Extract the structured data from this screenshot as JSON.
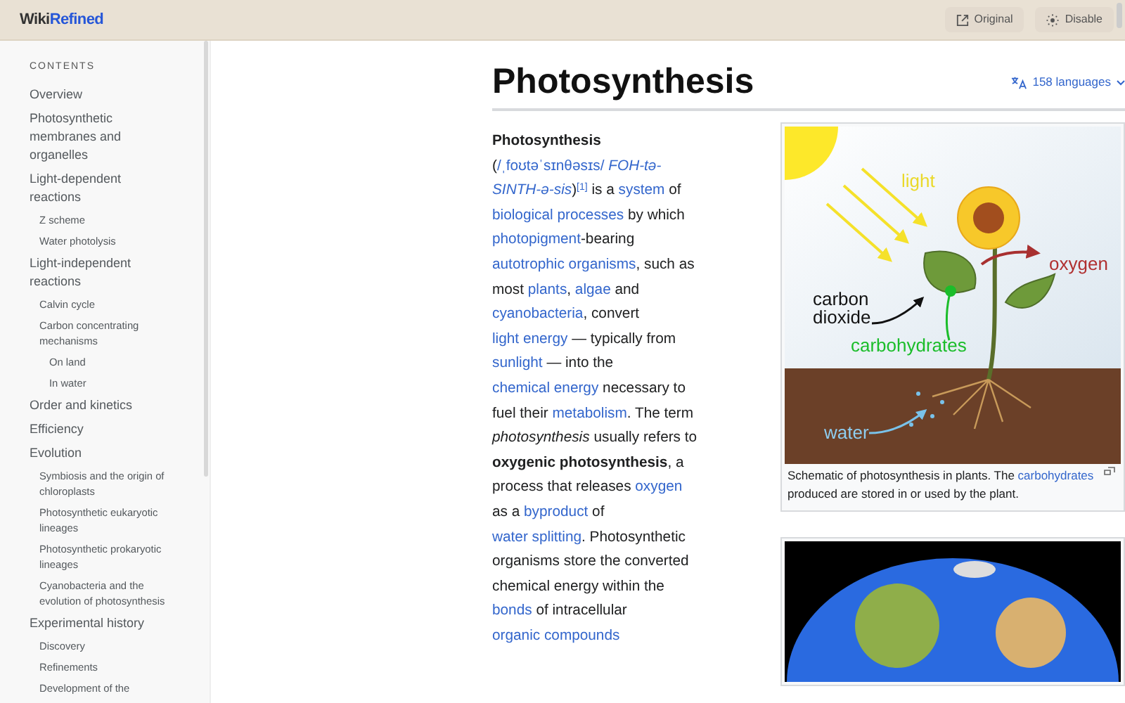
{
  "header": {
    "logo": {
      "prefix": "Wiki",
      "suffix": "Refined"
    },
    "buttons": [
      {
        "label": "Original",
        "kind": "external"
      },
      {
        "label": "Disable",
        "kind": "disable"
      }
    ]
  },
  "toc": {
    "heading": "CONTENTS",
    "items": [
      {
        "label": "Overview"
      },
      {
        "label": "Photosynthetic membranes and organelles"
      },
      {
        "label": "Light-dependent reactions",
        "children": [
          {
            "label": "Z scheme"
          },
          {
            "label": "Water photolysis"
          }
        ]
      },
      {
        "label": "Light-independent reactions",
        "children": [
          {
            "label": "Calvin cycle"
          },
          {
            "label": "Carbon concentrating mechanisms",
            "children": [
              {
                "label": "On land"
              },
              {
                "label": "In water"
              }
            ]
          }
        ]
      },
      {
        "label": "Order and kinetics"
      },
      {
        "label": "Efficiency"
      },
      {
        "label": "Evolution",
        "children": [
          {
            "label": "Symbiosis and the origin of chloroplasts"
          },
          {
            "label": "Photosynthetic eukaryotic lineages"
          },
          {
            "label": "Photosynthetic prokaryotic lineages"
          },
          {
            "label": "Cyanobacteria and the evolution of photosynthesis"
          }
        ]
      },
      {
        "label": "Experimental history",
        "children": [
          {
            "label": "Discovery"
          },
          {
            "label": "Refinements"
          },
          {
            "label": "Development of the"
          }
        ]
      }
    ]
  },
  "article": {
    "title": "Photosynthesis",
    "languages": "158 languages",
    "intro": [
      {
        "kind": "bold",
        "text": "Photosynthesis"
      },
      {
        "kind": "plain",
        "text": " ("
      },
      {
        "kind": "link",
        "text": "/ˌfoʊtəˈsɪnθəsɪs/"
      },
      {
        "kind": "italic-link",
        "text": "FOH-tə-"
      },
      {
        "kind": "italic-link",
        "text": "SINTH-ə-sis"
      },
      {
        "kind": "plain",
        "text": ")"
      },
      {
        "kind": "ref",
        "text": "[1]"
      },
      {
        "kind": "plain",
        "text": " is a "
      },
      {
        "kind": "link",
        "text": "system"
      },
      {
        "kind": "plain",
        "text": " of "
      },
      {
        "kind": "link",
        "text": "biological processes"
      },
      {
        "kind": "plain",
        "text": " by which "
      },
      {
        "kind": "link",
        "text": "photopigment"
      },
      {
        "kind": "plain",
        "text": "-bearing "
      },
      {
        "kind": "link",
        "text": "autotrophic organisms"
      },
      {
        "kind": "plain",
        "text": ", such as most "
      },
      {
        "kind": "link",
        "text": "plants"
      },
      {
        "kind": "plain",
        "text": ", "
      },
      {
        "kind": "link",
        "text": "algae"
      },
      {
        "kind": "plain",
        "text": " and "
      },
      {
        "kind": "link",
        "text": "cyanobacteria"
      },
      {
        "kind": "plain",
        "text": ", convert "
      },
      {
        "kind": "link",
        "text": "light energy"
      },
      {
        "kind": "plain",
        "text": " — typically from "
      },
      {
        "kind": "link",
        "text": "sunlight"
      },
      {
        "kind": "plain",
        "text": " — into the "
      },
      {
        "kind": "link",
        "text": "chemical energy"
      },
      {
        "kind": "plain",
        "text": " necessary to fuel their "
      },
      {
        "kind": "link",
        "text": "metabolism"
      },
      {
        "kind": "plain",
        "text": ". The term "
      },
      {
        "kind": "italic",
        "text": "photosynthesis"
      },
      {
        "kind": "plain",
        "text": " usually refers to "
      },
      {
        "kind": "bold",
        "text": "oxygenic photosynthesis"
      },
      {
        "kind": "plain",
        "text": ", a process that releases "
      },
      {
        "kind": "link",
        "text": "oxygen"
      },
      {
        "kind": "plain",
        "text": " as a "
      },
      {
        "kind": "link",
        "text": "byproduct"
      },
      {
        "kind": "plain",
        "text": " of "
      },
      {
        "kind": "link",
        "text": "water splitting"
      },
      {
        "kind": "plain",
        "text": ". Photosynthetic organisms store the converted chemical energy within the "
      },
      {
        "kind": "link",
        "text": "bonds"
      },
      {
        "kind": "plain",
        "text": " of intracellular "
      },
      {
        "kind": "link",
        "text": "organic compounds"
      }
    ],
    "figure": {
      "labels": {
        "light": "light",
        "oxygen": "oxygen",
        "carbon_dioxide": [
          "carbon",
          "dioxide"
        ],
        "carbohydrates": "carbohydrates",
        "water": "water"
      },
      "caption": [
        {
          "kind": "plain",
          "text": "Schematic of photosynthesis in plants. The "
        },
        {
          "kind": "link",
          "text": "carbohydrates"
        },
        {
          "kind": "plain",
          "text": " produced are stored in or used by the plant."
        }
      ]
    }
  }
}
